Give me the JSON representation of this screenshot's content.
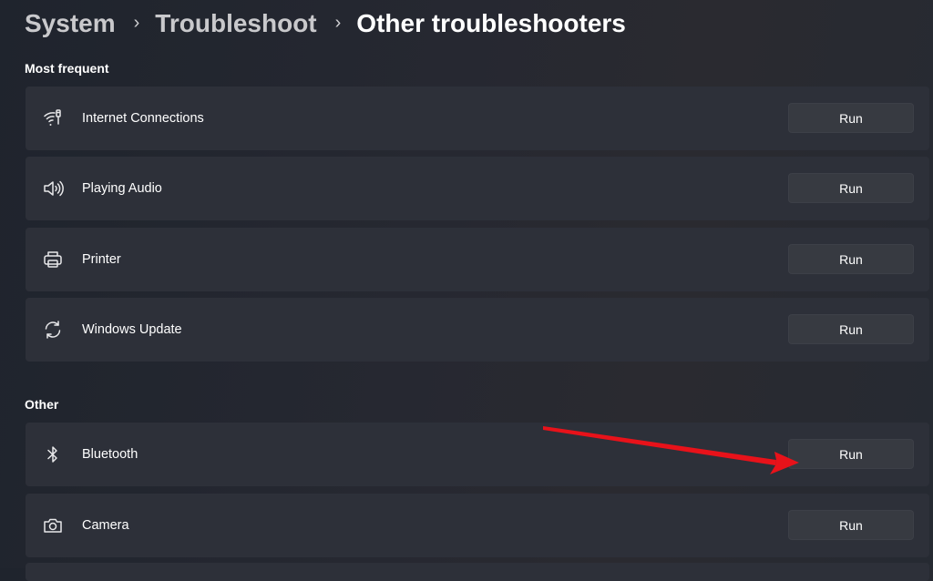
{
  "breadcrumb": {
    "items": [
      "System",
      "Troubleshoot",
      "Other troubleshooters"
    ],
    "separator": "›"
  },
  "sections": {
    "most_frequent": "Most frequent",
    "other": "Other"
  },
  "troubleshooters": {
    "internet": {
      "label": "Internet Connections",
      "button": "Run",
      "icon": "wifi-icon"
    },
    "audio": {
      "label": "Playing Audio",
      "button": "Run",
      "icon": "speaker-icon"
    },
    "printer": {
      "label": "Printer",
      "button": "Run",
      "icon": "printer-icon"
    },
    "windows_update": {
      "label": "Windows Update",
      "button": "Run",
      "icon": "sync-icon"
    },
    "bluetooth": {
      "label": "Bluetooth",
      "button": "Run",
      "icon": "bluetooth-icon"
    },
    "camera": {
      "label": "Camera",
      "button": "Run",
      "icon": "camera-icon"
    }
  },
  "colors": {
    "background": "#232529",
    "card": "#2d3039",
    "button": "#373a41",
    "annotation_arrow": "#e8121a"
  }
}
